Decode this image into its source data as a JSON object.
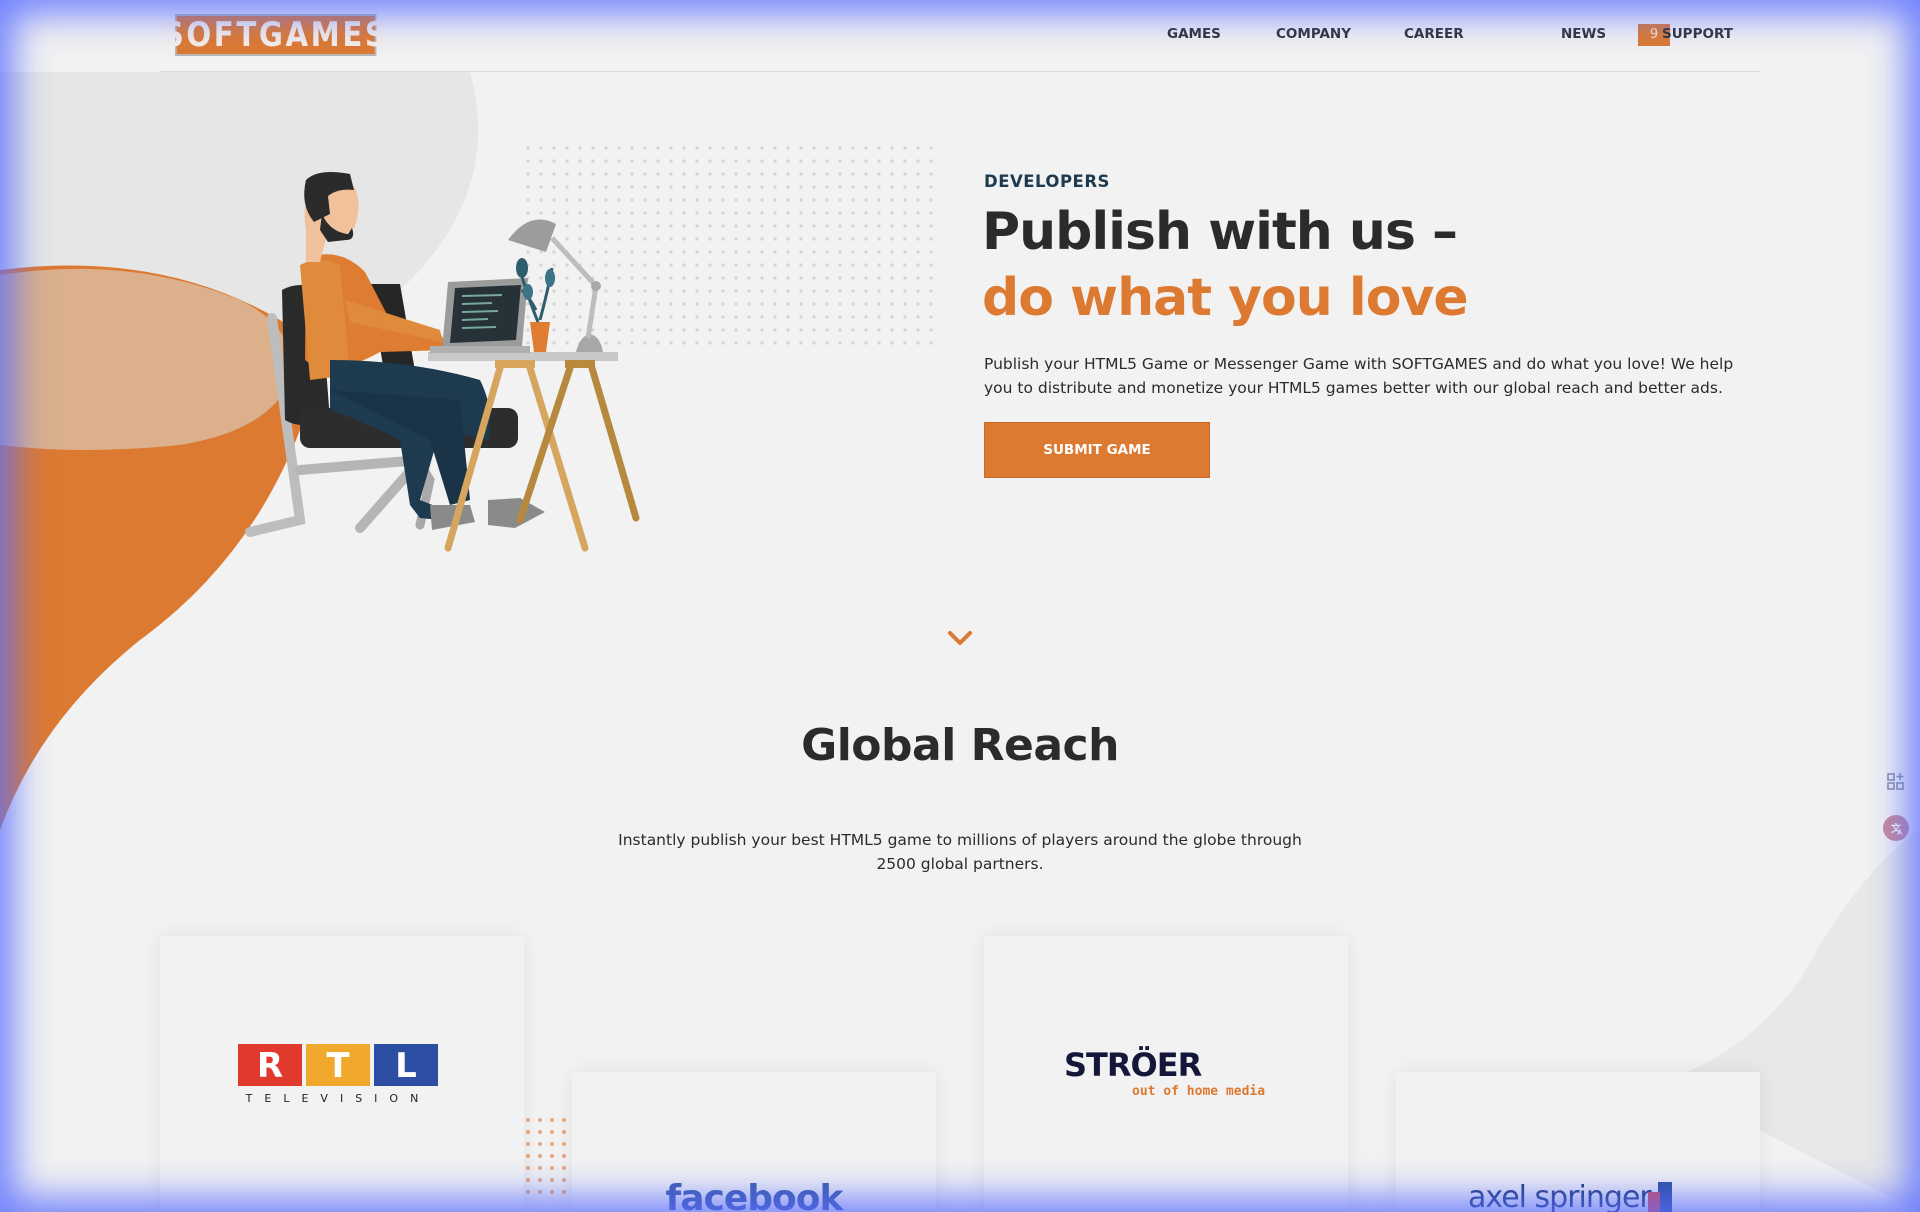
{
  "header": {
    "logo_text": "SOFTGAMES",
    "nav": [
      {
        "label": "GAMES"
      },
      {
        "label": "COMPANY"
      },
      {
        "label": "CAREER",
        "badge": "9"
      },
      {
        "label": "NEWS"
      },
      {
        "label": "SUPPORT"
      }
    ]
  },
  "hero": {
    "eyebrow": "DEVELOPERS",
    "title_line1": "Publish with us –",
    "title_line2": "do what you love",
    "description": "Publish your HTML5 Game or Messenger Game with SOFTGAMES and do what you love! We help you to distribute and monetize your HTML5 games better with our global reach and better ads.",
    "button_label": "SUBMIT GAME"
  },
  "reach": {
    "title": "Global Reach",
    "description": "Instantly publish your best HTML5 game to millions of players around the globe through 2500 global partners."
  },
  "partners": [
    {
      "logo_text": "RTL",
      "subtitle": "TELEVISION"
    },
    {
      "logo_text": "facebook"
    },
    {
      "logo_text": "STRÖER",
      "subtitle": "out of home media"
    },
    {
      "logo_text": "axel springer"
    }
  ],
  "icons": {
    "scroll_down": "chevron-down-icon",
    "side_tools": [
      "qr-code-icon",
      "translate-icon"
    ]
  },
  "colors": {
    "accent": "#dd7a31",
    "background": "#f2f2f2",
    "text": "#2b2b2b",
    "eyebrow": "#1e3a4f"
  }
}
